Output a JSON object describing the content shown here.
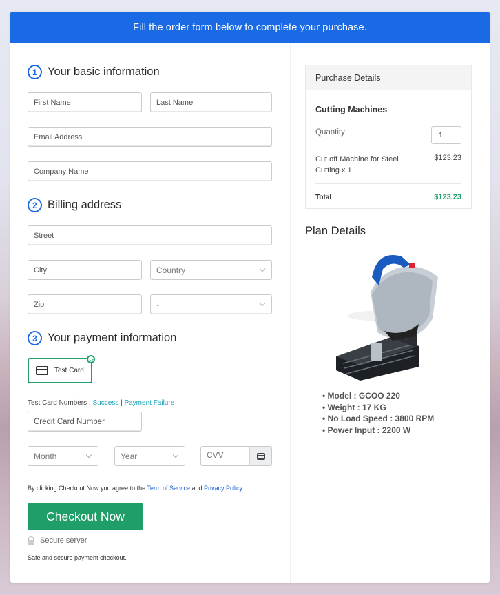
{
  "banner": {
    "text": "Fill the order form below to complete your purchase."
  },
  "sections": {
    "basic": {
      "num": "1",
      "title": "Your basic information"
    },
    "billing": {
      "num": "2",
      "title": "Billing address"
    },
    "payment": {
      "num": "3",
      "title": "Your payment information"
    }
  },
  "fields": {
    "first_name": "First Name",
    "last_name": "Last Name",
    "email": "Email Address",
    "company": "Company Name",
    "street": "Street",
    "city": "City",
    "country": "Country",
    "zip": "Zip",
    "state": "-",
    "card_number": "Credit Card Number",
    "month": "Month",
    "year": "Year",
    "cvv": "CVV"
  },
  "payment": {
    "method_label": "Test Card",
    "test_numbers_label": "Test Card Numbers :",
    "success_link": "Success",
    "separator": "|",
    "failure_link": "Payment Failure"
  },
  "terms": {
    "prefix": "By clicking Checkout Now you agree to the",
    "tos_link": "Term of Service",
    "and": "and",
    "privacy_link": "Privacy Policy"
  },
  "checkout_label": "Checkout Now",
  "secure_label": "Secure server",
  "safe_label": "Safe and secure payment checkout.",
  "purchase": {
    "header": "Purchase Details",
    "category": "Cutting Machines",
    "quantity_label": "Quantity",
    "quantity": "1",
    "item": "Cut off Machine for Steel Cutting x 1",
    "item_price": "$123.23",
    "total_label": "Total",
    "total": "$123.23"
  },
  "plan": {
    "title": "Plan Details",
    "image": "cut-off-machine-image",
    "specs": [
      "Model : GCOO 220",
      "Weight : 17 KG",
      "No Load Speed : 3800 RPM",
      "Power Input : 2200 W"
    ]
  },
  "colors": {
    "accent": "#1a6ae6",
    "success": "#22a06b",
    "button": "#1f9e68",
    "link": "#17a2b8"
  }
}
